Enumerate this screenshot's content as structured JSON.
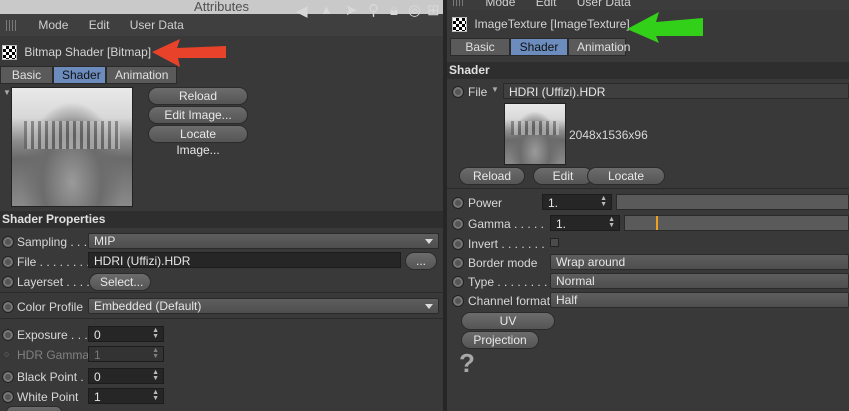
{
  "left": {
    "window_title": "Attributes",
    "menu": [
      "Mode",
      "Edit",
      "User Data"
    ],
    "object_title": "Bitmap Shader [Bitmap]",
    "tabs": [
      "Basic",
      "Shader",
      "Animation"
    ],
    "buttons": {
      "reload": "Reload Image...",
      "edit": "Edit Image...",
      "locate": "Locate Image..."
    },
    "section_title": "Shader Properties",
    "sampling": {
      "label": "Sampling . . .",
      "value": "MIP"
    },
    "file": {
      "label": "File . . . . . . . . .",
      "value": "HDRI (Uffizi).HDR",
      "browse": "..."
    },
    "layerset": {
      "label": "Layerset . . . .",
      "button": "Select..."
    },
    "color_profile": {
      "label": "Color Profile",
      "value": "Embedded (Default)"
    },
    "exposure": {
      "label": "Exposure . . .",
      "value": "0"
    },
    "hdr_gamma": {
      "label": "HDR Gamma",
      "value": "1"
    },
    "black_point": {
      "label": "Black Point .",
      "value": "0"
    },
    "white_point": {
      "label": "White Point",
      "value": "1"
    }
  },
  "right": {
    "menu": [
      "Mode",
      "Edit",
      "User Data"
    ],
    "object_title": "ImageTexture [ImageTexture]",
    "tabs": [
      "Basic",
      "Shader",
      "Animation"
    ],
    "section_title": "Shader",
    "file": {
      "label": "File",
      "value": "HDRI (Uffizi).HDR"
    },
    "resolution": "2048x1536x96",
    "buttons": {
      "reload": "Reload",
      "edit": "Edit",
      "locate": "Locate"
    },
    "power": {
      "label": "Power",
      "value": "1."
    },
    "gamma": {
      "label": "Gamma . . . . .",
      "value": "1.",
      "level": 0.14
    },
    "invert": {
      "label": "Invert . . . . . . ."
    },
    "border_mode": {
      "label": "Border mode",
      "value": "Wrap around"
    },
    "type": {
      "label": "Type . . . . . . . .",
      "value": "Normal"
    },
    "channel_format": {
      "label": "Channel format",
      "value": "Half"
    },
    "extra_buttons": {
      "uv_transform": "UV Transform",
      "projection": "Projection"
    },
    "help_glyph": "?"
  },
  "colors": {
    "red_arrow": "#e8432a",
    "green_arrow": "#33d01a",
    "active_tab": "#6b8cbd",
    "gamma_marker": "#f0a020"
  }
}
